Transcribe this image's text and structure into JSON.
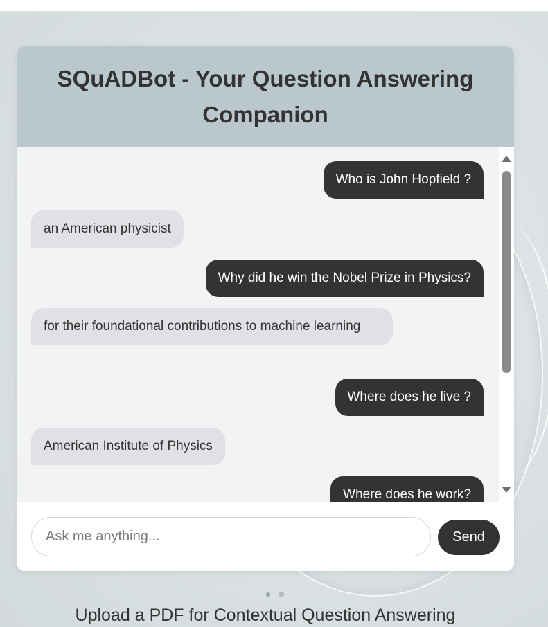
{
  "header": {
    "title": "SQuADBot - Your Question Answering Companion"
  },
  "messages": [
    {
      "role": "user",
      "text": "Who is John Hopfield ?"
    },
    {
      "role": "bot",
      "text": "an American physicist"
    },
    {
      "role": "user",
      "text": "Why did he win the Nobel Prize in Physics?"
    },
    {
      "role": "bot",
      "text": "for their foundational contributions to machine learning"
    },
    {
      "role": "user",
      "text": "Where does he live ?"
    },
    {
      "role": "bot",
      "text": "American Institute of Physics"
    },
    {
      "role": "user",
      "text": "Where does he work?"
    }
  ],
  "input": {
    "placeholder": "Ask me anything...",
    "value": ""
  },
  "send_button": {
    "label": "Send"
  },
  "upload": {
    "title": "Upload a PDF for Contextual Question Answering"
  },
  "colors": {
    "header_bg": "#bac8ce",
    "user_bubble": "#333333",
    "bot_bubble": "#dfe1e5",
    "button": "#333333"
  }
}
